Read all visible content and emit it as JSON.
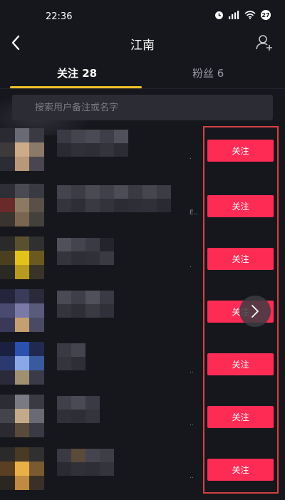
{
  "status": {
    "time": "22:36",
    "battery": "27"
  },
  "header": {
    "title": "江南"
  },
  "tabs": [
    {
      "label": "关注 28"
    },
    {
      "label": "粉丝 6"
    }
  ],
  "search": {
    "placeholder": "搜索用户备注或名字"
  },
  "users": [
    {
      "button": "关注",
      "suffix": "."
    },
    {
      "button": "关注",
      "suffix": "E.."
    },
    {
      "button": "关注",
      "suffix": "."
    },
    {
      "button": "关注",
      "suffix": ""
    },
    {
      "button": "关注",
      "suffix": ".."
    },
    {
      "button": "关注",
      "suffix": ".."
    },
    {
      "button": "关注",
      "suffix": ".."
    }
  ],
  "colors": {
    "follow": "#fe2c55",
    "tab_indicator": "#f2c229",
    "highlight": "#d34141"
  }
}
